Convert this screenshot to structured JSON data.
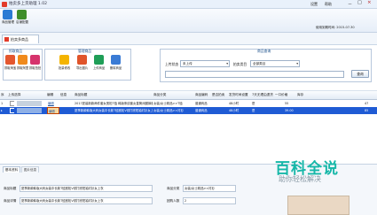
{
  "window": {
    "title": "拍卖多上货助理 1.02",
    "controls": [
      "设置",
      "帮助",
      "－",
      "□",
      "×"
    ]
  },
  "toolbar": {
    "buttons": [
      {
        "label": "商品管理",
        "color": "#2b7bd4"
      },
      {
        "label": "店铺配置",
        "color": "#3f8e2a"
      }
    ],
    "account": "使用到期时间: 2015-07-30"
  },
  "subtab": {
    "label": "拍卖多商品"
  },
  "ops": {
    "group1_title": "抓取商品",
    "group2_title": "管理商品",
    "group3_title": "商品查询",
    "buttons": [
      {
        "label": "抓取淘宝",
        "color": "#e4572e"
      },
      {
        "label": "抓取阿里",
        "color": "#f08a1c"
      },
      {
        "label": "抓取拍拍",
        "color": "#d6336c"
      },
      {
        "label": "批量修改",
        "color": "#f4b400"
      },
      {
        "label": "导出图片",
        "color": "#e0542a"
      },
      {
        "label": "上传商品",
        "color": "#1f9e57"
      },
      {
        "label": "删除商品",
        "color": "#3a7bd5"
      }
    ],
    "filter_status_label": "上传状态",
    "filter_status_value": "未上传",
    "filter_category_label": "拍卖类目",
    "filter_category_value": "全部类目",
    "search_placeholder": "",
    "search_button": "查询"
  },
  "grid": {
    "headers": [
      "序",
      "上传选择",
      "编辑",
      "信息",
      "商品标题",
      "商品分类",
      "商品编码",
      "是否拍卖",
      "发货时间设置",
      "7天无理由退货",
      "一口价格",
      "库存"
    ],
    "rows": [
      {
        "no": "1",
        "edit": "编辑",
        "title": "2017夏装新款两件套女宽松T恤 韩版条纹套女直筒阔腿裤套装",
        "category": "女装/女士精品>>T恤",
        "type": "普通商品",
        "auction": "",
        "ship": "48小时",
        "refund": "是",
        "price": "55",
        "stock": "47"
      },
      {
        "no": "2",
        "edit": "编辑",
        "title": "夏季新款韩版大码女装中长款T恤宽松V领打底短袖衬衫女上衣",
        "category": "女装/女士精品>>衬衫",
        "type": "普通商品",
        "auction": "",
        "ship": "48小时",
        "refund": "是",
        "price": "39.00",
        "stock": "85"
      }
    ]
  },
  "detail": {
    "tabs": [
      "基本资料",
      "图片信息"
    ],
    "label_title": "商品标题",
    "value_title": "夏季新款韩版大码女装中长款T恤宽松V领打底短袖衬衫女上衣",
    "label_desc": "商品详情",
    "value_desc": "夏季新款韩版大码女装中长款T恤宽松V领打底短袖衬衫女上衣",
    "label_cat": "商品分类",
    "value_cat": "女装/女士精品>>衬衫",
    "label_count": "团购人数",
    "value_count": "2"
  },
  "watermark": {
    "main": "百科全说",
    "sub": "助你轻松解决"
  }
}
